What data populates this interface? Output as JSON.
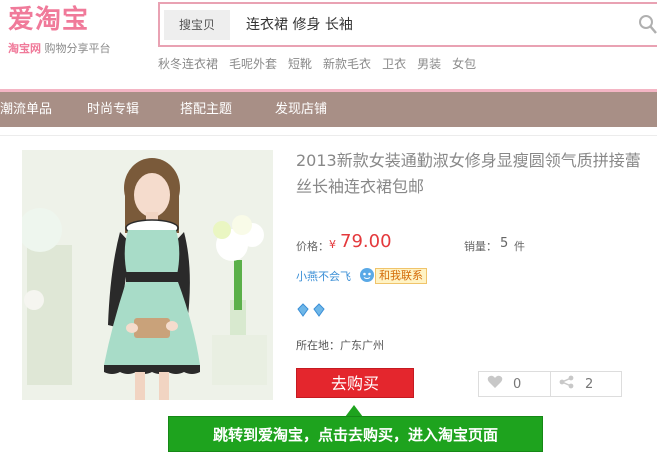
{
  "header": {
    "logo_main": "爱淘宝",
    "logo_brand": "淘宝网",
    "logo_tagline": "购物分享平台",
    "search_scope": "搜宝贝",
    "search_value": "连衣裙 修身 长袖",
    "hot_words": [
      "秋冬连衣裙",
      "毛呢外套",
      "短靴",
      "新款毛衣",
      "卫衣",
      "男装",
      "女包"
    ]
  },
  "nav": {
    "items": [
      "潮流单品",
      "时尚专辑",
      "搭配主题",
      "发现店铺"
    ]
  },
  "product": {
    "title": "2013新款女装通勤淑女修身显瘦圆领气质拼接蕾丝长袖连衣裙包邮",
    "price_label": "价格：",
    "price_currency": "¥",
    "price_value": "79.00",
    "sales_label": "销量：",
    "sales_value": "5",
    "sales_unit": "件",
    "seller_name": "小燕不会飞",
    "contact_label": "和我联系",
    "location": "所在地：广东广州",
    "buy_label": "去购买",
    "likes": "0",
    "shares": "2"
  },
  "tooltip": {
    "text": "跳转到爱淘宝，点击去购买，进入淘宝页面"
  },
  "colors": {
    "brand_pink": "#f07a9a",
    "nav_bg": "#a88f86",
    "price_red": "#e4393c",
    "buy_red": "#e4262d",
    "tooltip_green": "#1ea31e",
    "seller_blue": "#3b8fd6"
  }
}
